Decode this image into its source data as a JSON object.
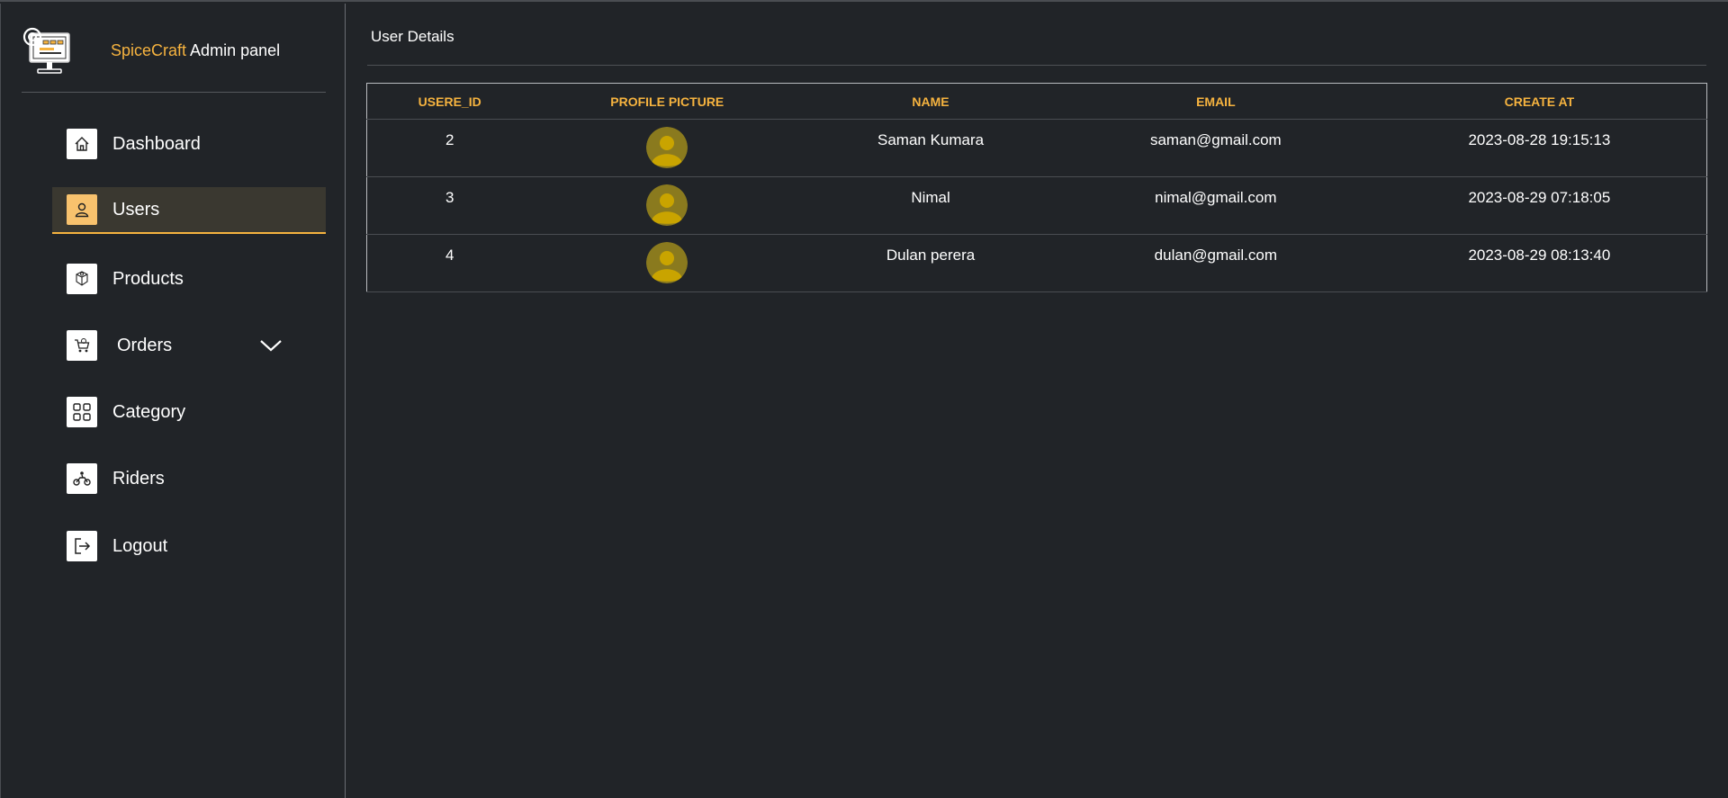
{
  "brand": {
    "accent": "SpiceCraft",
    "rest": " Admin panel"
  },
  "sidebar": {
    "items": [
      {
        "label": "Dashboard",
        "icon": "home-icon"
      },
      {
        "label": "Users",
        "icon": "user-icon",
        "active": true
      },
      {
        "label": "Products",
        "icon": "product-box-icon"
      },
      {
        "label": "Orders",
        "icon": "cart-icon",
        "expandable": true
      },
      {
        "label": "Category",
        "icon": "grid-icon"
      },
      {
        "label": "Riders",
        "icon": "motorbike-icon"
      },
      {
        "label": "Logout",
        "icon": "logout-icon"
      }
    ]
  },
  "main": {
    "title": "User Details",
    "table": {
      "headers": [
        "USERE_ID",
        "PROFILE PICTURE",
        "NAME",
        "EMAIL",
        "CREATE AT"
      ],
      "rows": [
        {
          "id": "2",
          "name": "Saman Kumara",
          "email": "saman@gmail.com",
          "created": "2023-08-28 19:15:13"
        },
        {
          "id": "3",
          "name": "Nimal",
          "email": "nimal@gmail.com",
          "created": "2023-08-29 07:18:05"
        },
        {
          "id": "4",
          "name": "Dulan perera",
          "email": "dulan@gmail.com",
          "created": "2023-08-29 08:13:40"
        }
      ]
    }
  },
  "colors": {
    "background": "#212428",
    "accent": "#f6b33f",
    "active_bg": "#3a3830",
    "avatar": "#8a7a1e"
  }
}
